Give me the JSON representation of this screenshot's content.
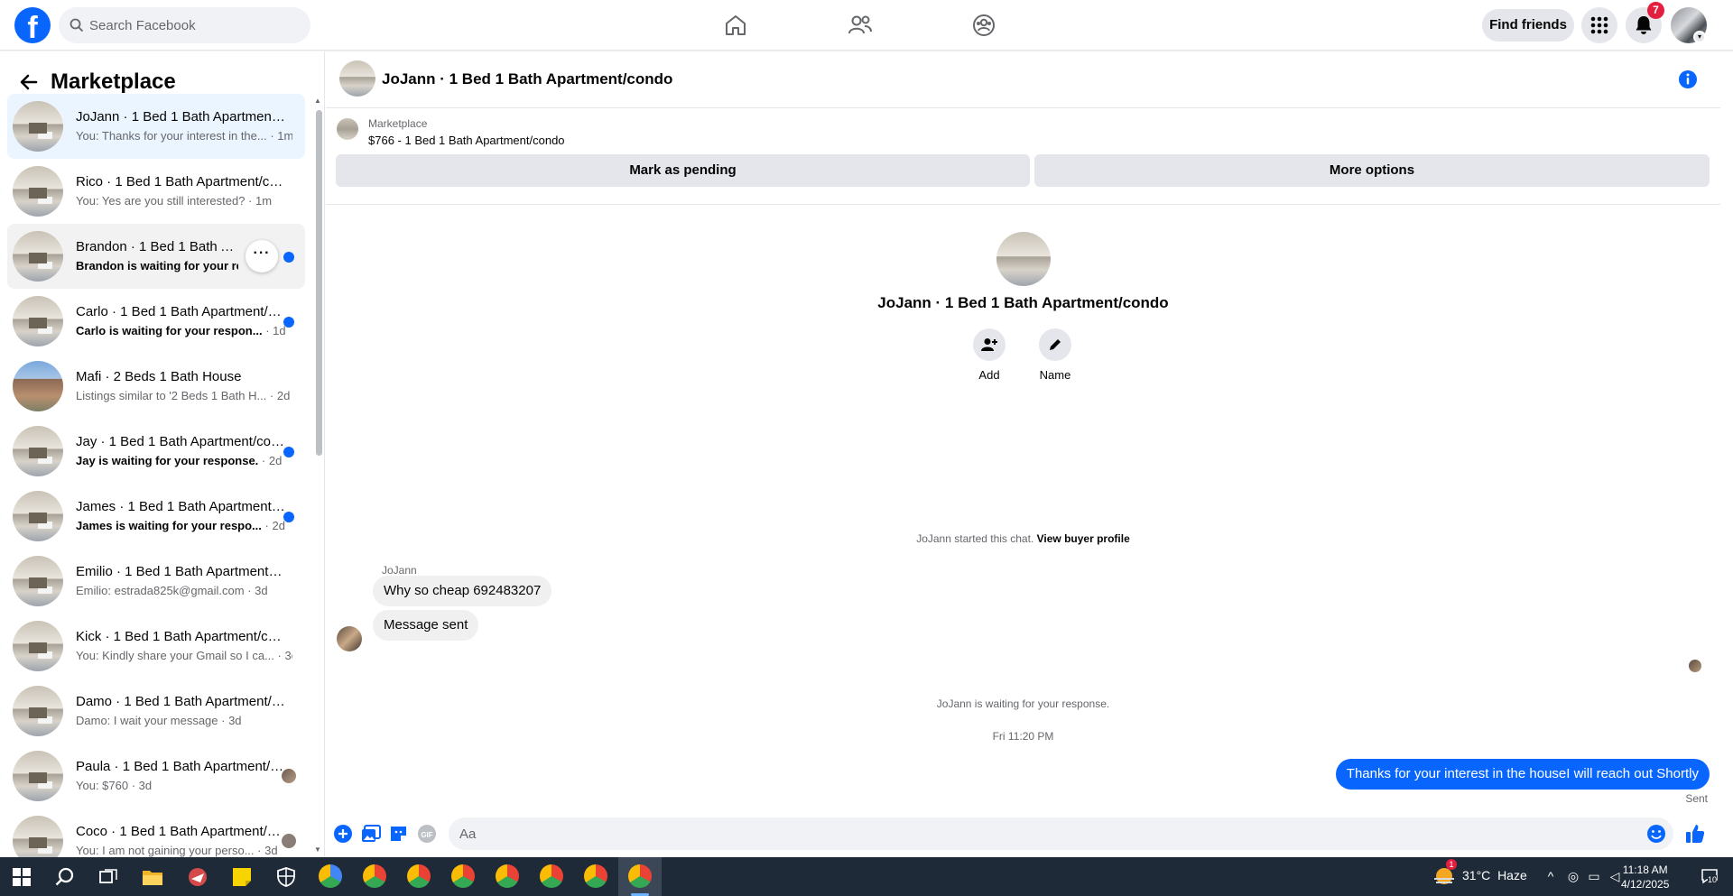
{
  "header": {
    "logo_letter": "f",
    "search_placeholder": "Search Facebook",
    "nav_icons": [
      "home-icon",
      "friends-icon",
      "marketplace-profile-icon"
    ],
    "find_friends": "Find friends",
    "notification_count": "7"
  },
  "sidebar": {
    "title": "Marketplace",
    "conversations": [
      {
        "name": "JoJann · 1 Bed 1 Bath Apartment/condo",
        "snippet": "You: Thanks for your interest in the...",
        "time": "1m",
        "state": "active"
      },
      {
        "name": "Rico · 1 Bed 1 Bath Apartment/condo",
        "snippet": "You: Yes are you still interested?",
        "time": "1m",
        "state": "read"
      },
      {
        "name": "Brandon · 1 Bed 1 Bath Apart",
        "snippet": "Brandon is waiting for your res...",
        "time": "",
        "state": "unread-hover"
      },
      {
        "name": "Carlo · 1 Bed 1 Bath Apartment/condo",
        "snippet": "Carlo is waiting for your respon...",
        "time": "1d",
        "state": "unread"
      },
      {
        "name": "Mafi · 2 Beds 1 Bath House",
        "snippet": "Listings similar to '2 Beds 1 Bath H...",
        "time": "2d",
        "state": "read"
      },
      {
        "name": "Jay · 1 Bed 1 Bath Apartment/condo",
        "snippet": "Jay is waiting for your response.",
        "time": "2d",
        "state": "unread"
      },
      {
        "name": "James · 1 Bed 1 Bath Apartment/condo",
        "snippet": "James is waiting for your respo...",
        "time": "2d",
        "state": "unread"
      },
      {
        "name": "Emilio · 1 Bed 1 Bath Apartment/condo",
        "snippet": "Emilio: estrada825k@gmail.com",
        "time": "3d",
        "state": "read"
      },
      {
        "name": "Kick · 1 Bed 1 Bath Apartment/condo",
        "snippet": "You: Kindly share your Gmail so I ca...",
        "time": "3d",
        "state": "read"
      },
      {
        "name": "Damo · 1 Bed 1 Bath Apartment/condo",
        "snippet": "Damo: I wait your message",
        "time": "3d",
        "state": "read"
      },
      {
        "name": "Paula · 1 Bed 1 Bath Apartment/condo",
        "snippet": "You: $760",
        "time": "3d",
        "state": "seen"
      },
      {
        "name": "Coco · 1 Bed 1 Bath Apartment/condo",
        "snippet": "You: I am not gaining your perso...",
        "time": "3d",
        "state": "seen"
      }
    ]
  },
  "chat": {
    "title": "JoJann · 1 Bed 1 Bath Apartment/condo",
    "listing_label": "Marketplace",
    "listing_price": "$766 - 1 Bed 1 Bath Apartment/condo",
    "mark_pending": "Mark as pending",
    "more_options": "More options",
    "add_label": "Add",
    "name_label": "Name",
    "started_text": "JoJann started this chat.",
    "view_buyer": "View buyer profile",
    "sender_name": "JoJann",
    "incoming": [
      "Why so cheap 692483207",
      "Message sent"
    ],
    "waiting_text": "JoJann is waiting for your response.",
    "timestamp": "Fri 11:20 PM",
    "outgoing": "Thanks for your interest in the houseI will reach out Shortly",
    "sent_label": "Sent",
    "composer_placeholder": "Aa"
  },
  "taskbar": {
    "weather_temp": "31°C",
    "weather_cond": "Haze",
    "time": "11:18 AM",
    "date": "4/12/2025",
    "notif_count": "10",
    "weather_badge": "1"
  },
  "colors": {
    "brand_blue": "#0866ff",
    "badge_red": "#e41e3f",
    "taskbar": "#1f2a38"
  }
}
